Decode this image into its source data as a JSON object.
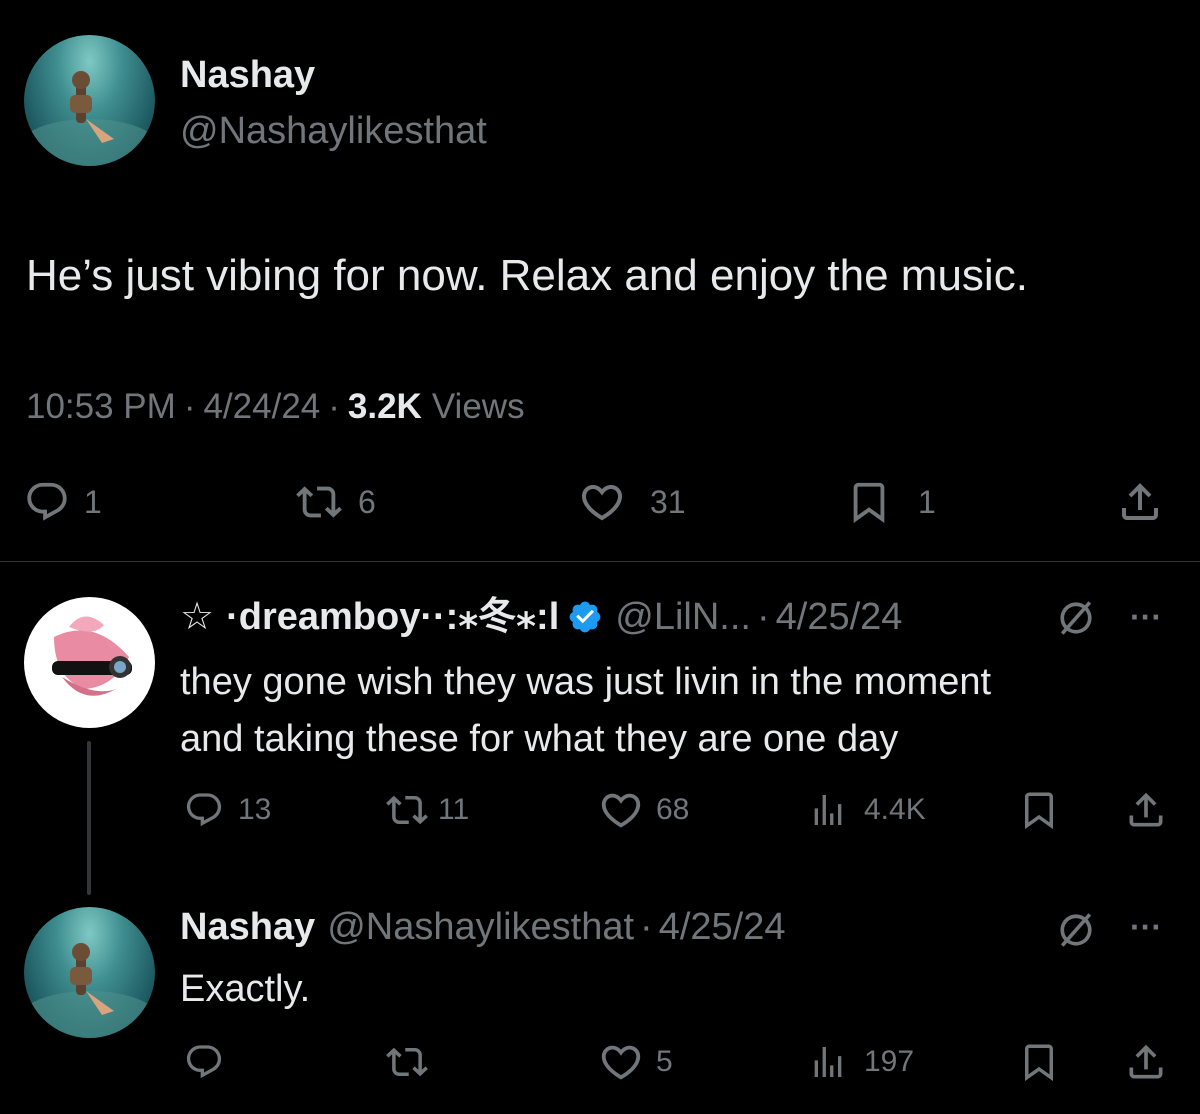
{
  "main_tweet": {
    "author": "Nashay",
    "handle": "@Nashaylikesthat",
    "text": "He’s just vibing for now. Relax and enjoy the music.",
    "time": "10:53 PM",
    "sep1": "·",
    "date": "4/24/24",
    "sep2": "·",
    "views_count": "3.2K",
    "views_label": "Views",
    "replies": "1",
    "reposts": "6",
    "likes": "31",
    "bookmarks": "1"
  },
  "reply1": {
    "star": "☆",
    "author": "·dreamboy··:⁎冬⁎:l",
    "handle": "@LilN...",
    "sep": "·",
    "date": "4/25/24",
    "more": "···",
    "text_line1": "they gone wish they was just livin in the moment",
    "text_line2": "and taking these for what they are one day",
    "replies": "13",
    "reposts": "11",
    "likes": "68",
    "views": "4.4K"
  },
  "reply2": {
    "author": "Nashay",
    "handle": "@Nashaylikesthat",
    "sep": "·",
    "date": "4/25/24",
    "more": "···",
    "text": "Exactly.",
    "likes": "5",
    "views": "197"
  },
  "colors": {
    "background": "#000000",
    "text": "#e7e9ea",
    "muted": "#71767b",
    "verified": "#1d9bf0",
    "divider": "#2f3336"
  },
  "icons": [
    "reply-icon",
    "repost-icon",
    "like-icon",
    "bookmark-icon",
    "share-icon",
    "views-icon",
    "verified-badge-icon",
    "grok-icon",
    "more-icon"
  ]
}
